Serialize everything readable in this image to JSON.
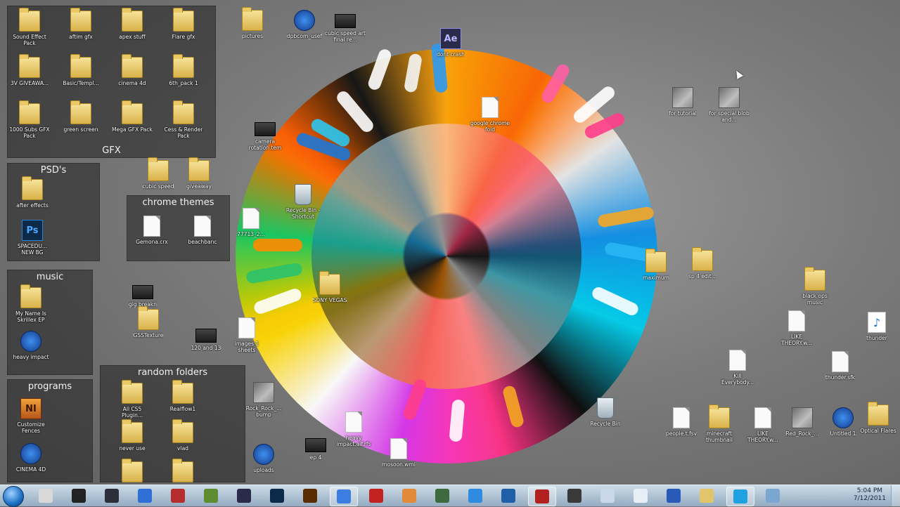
{
  "fences": [
    {
      "id": "gfx",
      "title": "GFX",
      "title_pos": "bottom",
      "icons": [
        {
          "label": "Sound Effect Pack",
          "type": "folder"
        },
        {
          "label": "aftim gfx",
          "type": "folder"
        },
        {
          "label": "apex stuff",
          "type": "folder"
        },
        {
          "label": "Flare gfx",
          "type": "folder"
        },
        {
          "label": "3V GIVEAWA...",
          "type": "folder"
        },
        {
          "label": "Basic/Templ...",
          "type": "folder"
        },
        {
          "label": "cinema 4d",
          "type": "folder"
        },
        {
          "label": "6th_pack 1",
          "type": "folder"
        },
        {
          "label": "1000 Subs GFX Pack",
          "type": "folder"
        },
        {
          "label": "green screen",
          "type": "folder"
        },
        {
          "label": "Mega GFX Pack",
          "type": "folder"
        },
        {
          "label": "Cess & Render Pack",
          "type": "folder"
        }
      ]
    },
    {
      "id": "psds",
      "title": "PSD's",
      "title_pos": "top",
      "icons": [
        {
          "label": "after effects",
          "type": "folder"
        },
        {
          "label": "SPACEDU... NEW BG",
          "type": "ps"
        }
      ]
    },
    {
      "id": "chrome",
      "title": "chrome themes",
      "title_pos": "top",
      "icons": [
        {
          "label": "Gemona.crx",
          "type": "file"
        },
        {
          "label": "beachbanc",
          "type": "file"
        }
      ]
    },
    {
      "id": "music",
      "title": "music",
      "title_pos": "top",
      "icons": [
        {
          "label": "My Name Is Skrillex EP",
          "type": "folder"
        },
        {
          "label": "heavy impact",
          "type": "app"
        }
      ]
    },
    {
      "id": "programs",
      "title": "programs",
      "title_pos": "top",
      "icons": [
        {
          "label": "Customize Fences",
          "type": "ni"
        },
        {
          "label": "CINEMA 4D",
          "type": "app"
        }
      ]
    },
    {
      "id": "random",
      "title": "random folders",
      "title_pos": "top",
      "icons": [
        {
          "label": "All CS5 Plugin...",
          "type": "folder"
        },
        {
          "label": "Realflow1",
          "type": "folder"
        },
        {
          "label": "never use",
          "type": "folder"
        },
        {
          "label": "vlad",
          "type": "folder"
        },
        {
          "label": "",
          "type": "folder"
        },
        {
          "label": "",
          "type": "folder"
        }
      ]
    }
  ],
  "desktop_icons": [
    {
      "label": "pictures",
      "type": "folder"
    },
    {
      "label": "dpbcom_usef",
      "type": "app"
    },
    {
      "label": "cubic speed art final re...",
      "type": "vid"
    },
    {
      "label": "dont crash",
      "type": "ae"
    },
    {
      "label": "for tutorial",
      "type": "img"
    },
    {
      "label": "for special blob and...",
      "type": "img"
    },
    {
      "label": "camera rotation.tem",
      "type": "vid"
    },
    {
      "label": "cubic speed",
      "type": "folder"
    },
    {
      "label": "giveaway",
      "type": "folder"
    },
    {
      "label": "Recycle Bin - Shortcut",
      "type": "bin"
    },
    {
      "label": "77713_2...",
      "type": "file"
    },
    {
      "label": "gig breakn",
      "type": "vid"
    },
    {
      "label": "GSSTexture",
      "type": "folder"
    },
    {
      "label": "120 and 13",
      "type": "vid"
    },
    {
      "label": "images 1 sheets",
      "type": "file"
    },
    {
      "label": "Rock_Rock_... bump",
      "type": "img"
    },
    {
      "label": "uploads",
      "type": "app"
    },
    {
      "label": "ep 4",
      "type": "vid"
    },
    {
      "label": "heavy impact.aif.rfs",
      "type": "file"
    },
    {
      "label": "mosoon.wmi",
      "type": "file"
    },
    {
      "label": "SONY VEGAS",
      "type": "folder"
    },
    {
      "label": "google chrome fold",
      "type": "file"
    },
    {
      "label": "Recycle Bin",
      "type": "bin"
    },
    {
      "label": "maximum",
      "type": "folder"
    },
    {
      "label": "sp 4 edit...",
      "type": "folder"
    },
    {
      "label": "black ops music",
      "type": "folder"
    },
    {
      "label": "LIKE THEORY.w...",
      "type": "file"
    },
    {
      "label": "thunder",
      "type": "music"
    },
    {
      "label": "Kill Everybody...",
      "type": "file"
    },
    {
      "label": "thunder.sfk",
      "type": "file"
    },
    {
      "label": "people.t.fsv",
      "type": "file"
    },
    {
      "label": "minecraft thumbnail",
      "type": "folder"
    },
    {
      "label": "LIKE THEORY.w...",
      "type": "file"
    },
    {
      "label": "Red_Rock_...",
      "type": "img"
    },
    {
      "label": "Untitled 1",
      "type": "app"
    },
    {
      "label": "Optical Flares",
      "type": "folder"
    }
  ],
  "taskbar": {
    "buttons": [
      {
        "name": "explorer",
        "color": "#d8d8d8"
      },
      {
        "name": "cmd",
        "color": "#222222"
      },
      {
        "name": "steam",
        "color": "#2a2f3a"
      },
      {
        "name": "cinema4d",
        "color": "#2f6fd6"
      },
      {
        "name": "winrar",
        "color": "#b52d2d"
      },
      {
        "name": "minecraft",
        "color": "#5e8c31"
      },
      {
        "name": "aftereffects",
        "color": "#2a2a4a"
      },
      {
        "name": "photoshop",
        "color": "#0b2a4a"
      },
      {
        "name": "illustrator",
        "color": "#5a2d00"
      },
      {
        "name": "chrome",
        "color": "#3b7de0"
      },
      {
        "name": "app-red",
        "color": "#c32222"
      },
      {
        "name": "pencil",
        "color": "#e08a3a"
      },
      {
        "name": "app-green",
        "color": "#3e6b3e"
      },
      {
        "name": "paint",
        "color": "#2f8be0"
      },
      {
        "name": "app-blue",
        "color": "#1f5fa8"
      },
      {
        "name": "media",
        "color": "#b32020"
      },
      {
        "name": "app-tv",
        "color": "#3a3a3a"
      },
      {
        "name": "app-window",
        "color": "#c8d8e8"
      },
      {
        "name": "notepad",
        "color": "#e6eef6"
      },
      {
        "name": "word",
        "color": "#2a5ab8"
      },
      {
        "name": "folder",
        "color": "#e2c46a"
      },
      {
        "name": "skype",
        "color": "#1fa0e0"
      },
      {
        "name": "app-screen",
        "color": "#7aa6d0"
      }
    ],
    "active": [
      9,
      15,
      21
    ],
    "clock_time": "5:04 PM",
    "clock_date": "7/12/2011"
  }
}
